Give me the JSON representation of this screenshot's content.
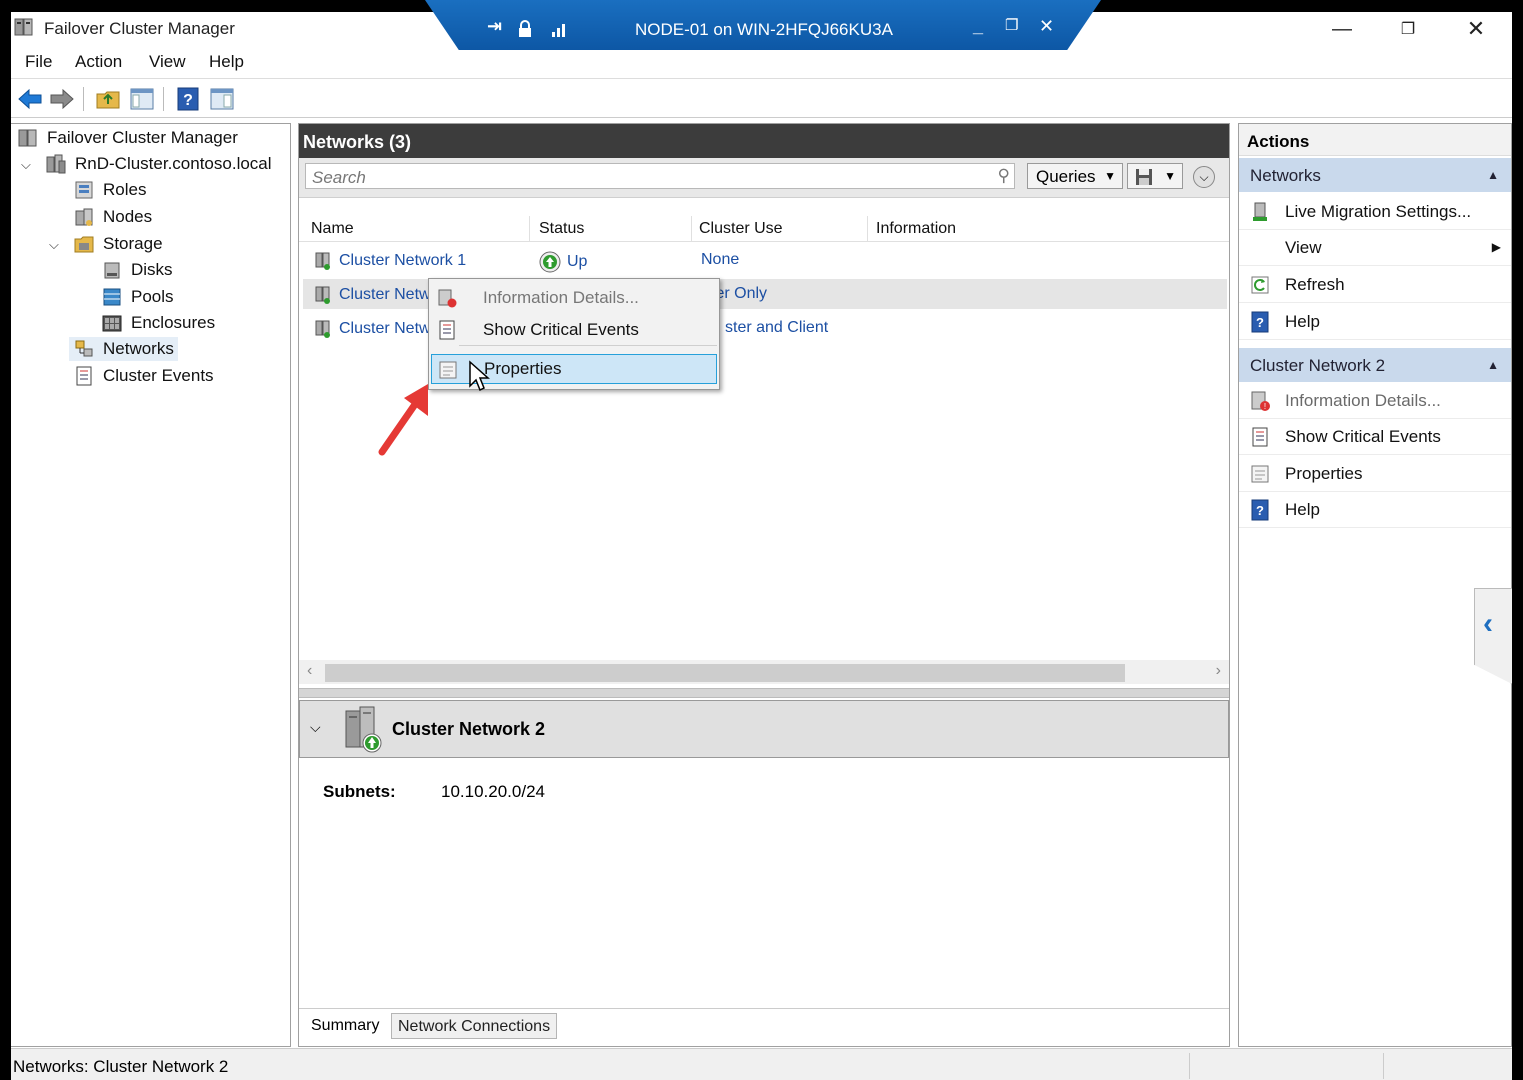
{
  "window": {
    "title": "Failover Cluster Manager"
  },
  "rdp": {
    "title": "NODE-01 on WIN-2HFQJ66KU3A"
  },
  "menu": [
    "File",
    "Action",
    "View",
    "Help"
  ],
  "tree": {
    "root": "Failover Cluster Manager",
    "cluster": "RnD-Cluster.contoso.local",
    "roles": "Roles",
    "nodes": "Nodes",
    "storage": "Storage",
    "disks": "Disks",
    "pools": "Pools",
    "enclosures": "Enclosures",
    "networks": "Networks",
    "events": "Cluster Events"
  },
  "center": {
    "title": "Networks (3)",
    "search_placeholder": "Search",
    "queries_label": "Queries",
    "columns": [
      "Name",
      "Status",
      "Cluster Use",
      "Information"
    ],
    "rows": [
      {
        "name": "Cluster Network 1",
        "status": "Up",
        "use": "None"
      },
      {
        "name": "Cluster Netw",
        "status": "",
        "use": "ster Only"
      },
      {
        "name": "Cluster Netw",
        "status": "",
        "use": "ster and Client"
      }
    ]
  },
  "detail": {
    "title": "Cluster Network 2",
    "subnets_label": "Subnets:",
    "subnets_value": "10.10.20.0/24",
    "tabs": [
      "Summary",
      "Network Connections"
    ]
  },
  "context_menu": [
    "Information Details...",
    "Show Critical Events",
    "Properties"
  ],
  "actions": {
    "title": "Actions",
    "section1": "Networks",
    "section1_items": [
      "Live Migration Settings...",
      "View",
      "Refresh",
      "Help"
    ],
    "section2": "Cluster Network 2",
    "section2_items": [
      "Information Details...",
      "Show Critical Events",
      "Properties",
      "Help"
    ]
  },
  "status": {
    "text": "Networks:  Cluster Network 2"
  },
  "colors": {
    "selection": "#cde6f7",
    "accent": "#26a0da",
    "header_dark": "#3c3c3c",
    "action_section": "#c9d9ec",
    "link": "#1c4fa3"
  }
}
